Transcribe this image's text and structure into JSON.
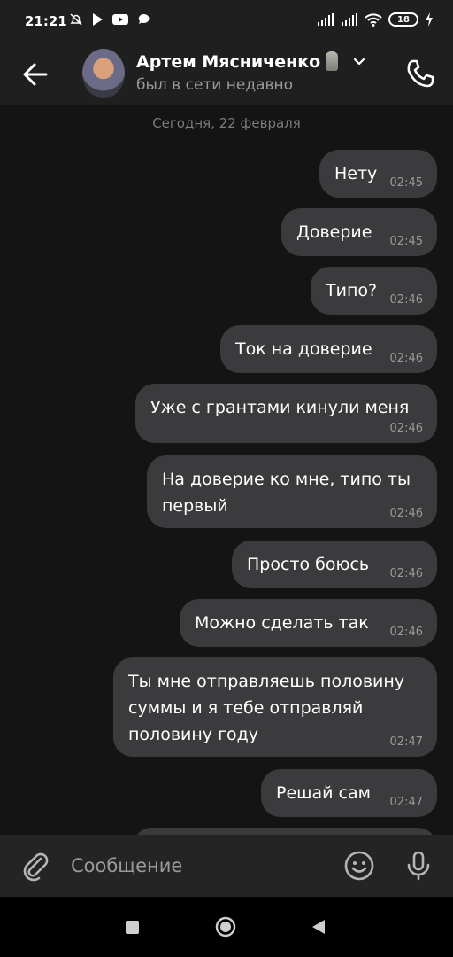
{
  "status_bar": {
    "time": "21:21",
    "battery": "18"
  },
  "header": {
    "contact_name": "Артем Мясниченко",
    "status": "был в сети недавно"
  },
  "chat": {
    "date_separator": "Сегодня, 22 февраля",
    "messages": [
      {
        "text": "Нету",
        "time": "02:45"
      },
      {
        "text": "Доверие",
        "time": "02:45"
      },
      {
        "text": "Типо?",
        "time": "02:46"
      },
      {
        "text": "Ток на доверие",
        "time": "02:46"
      },
      {
        "text": "Уже с грантами кинули меня",
        "time": "02:46"
      },
      {
        "text": "На доверие ко мне, типо ты\nпервый",
        "time": "02:46"
      },
      {
        "text": "Просто боюсь",
        "time": "02:46"
      },
      {
        "text": "Можно сделать так",
        "time": "02:46"
      },
      {
        "text": "Ты мне отправляешь половину\nсуммы и я тебе отправляй\nполовину году",
        "time": "02:47"
      },
      {
        "text": "Решай сам",
        "time": "02:47"
      }
    ]
  },
  "input": {
    "placeholder": "Сообщение"
  },
  "colors": {
    "background": "#141414",
    "bubble": "#3b3b3d",
    "bar": "#1f1f1f"
  }
}
